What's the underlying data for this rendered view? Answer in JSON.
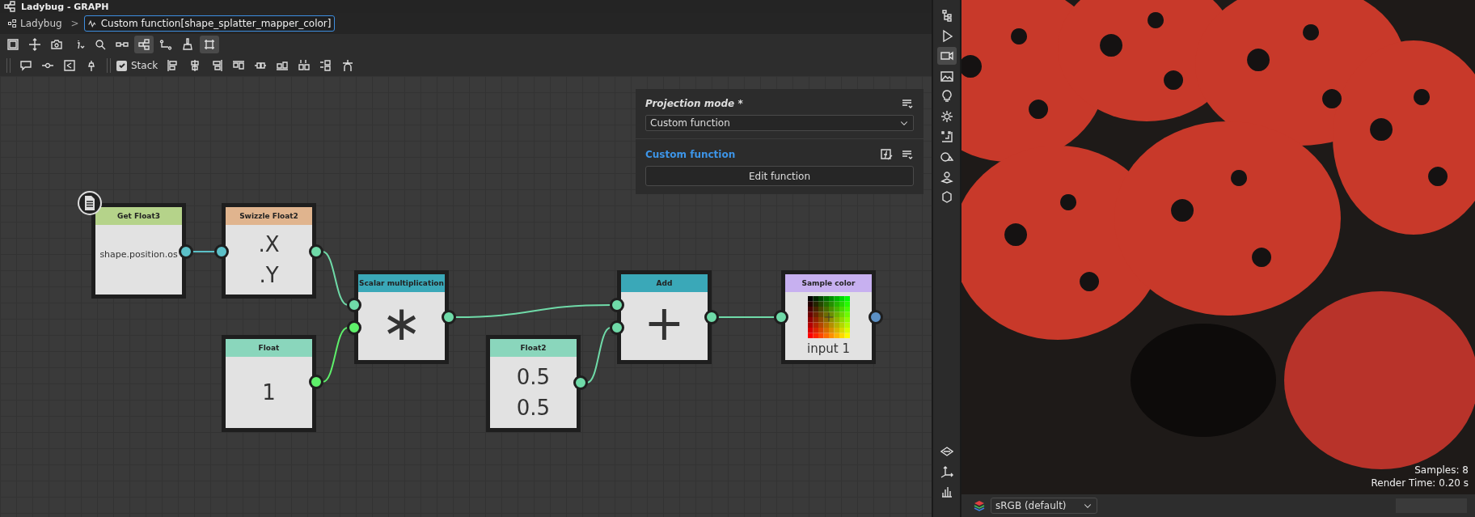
{
  "window": {
    "title": "Ladybug - GRAPH"
  },
  "breadcrumb": {
    "root": "Ladybug",
    "separator": ">",
    "current": "Custom function[shape_splatter_mapper_color]"
  },
  "toolbar_1": [
    {
      "selected": false
    },
    {
      "selected": false
    },
    {
      "selected": false
    },
    {
      "selected": false
    },
    {
      "selected": false
    },
    {
      "selected": false
    },
    {
      "selected": true
    },
    {
      "selected": false
    },
    {
      "selected": false
    },
    {
      "selected": true
    }
  ],
  "toolbar_2": {
    "stack": {
      "label": "Stack",
      "checked": true
    }
  },
  "nodes": [
    {
      "kind": "text",
      "title": "Get Float3",
      "color": "#b5d38a",
      "lines": [
        "shape.position.os"
      ]
    },
    {
      "kind": "values",
      "title": "Swizzle Float2",
      "color": "#e0b48e",
      "lines": [
        ".X",
        ".Y"
      ]
    },
    {
      "kind": "operator",
      "title": "Scalar multiplication",
      "color": "#3aa8b8",
      "lines": [
        "∗"
      ]
    },
    {
      "kind": "values",
      "title": "Float",
      "color": "#8ad6bc",
      "lines": [
        "1"
      ]
    },
    {
      "kind": "values",
      "title": "Float2",
      "color": "#8ad6bc",
      "lines": [
        "0.5",
        "0.5"
      ]
    },
    {
      "kind": "operator",
      "title": "Add",
      "color": "#3aa8b8",
      "lines": [
        "+"
      ]
    },
    {
      "kind": "color",
      "title": "Sample color",
      "color": "#c7b0f0",
      "lines": [
        "input 1"
      ]
    }
  ],
  "properties": {
    "projection_label": "Projection mode *",
    "projection_value": "Custom function",
    "section": "Custom function",
    "button": "Edit function"
  },
  "side_tools": [
    {
      "selected": false
    },
    {
      "selected": false
    },
    {
      "selected": true
    },
    {
      "selected": false
    },
    {
      "selected": false
    },
    {
      "selected": false
    },
    {
      "selected": false
    },
    {
      "selected": false
    },
    {
      "selected": false
    },
    {
      "selected": false
    },
    {
      "selected": false
    },
    {
      "selected": false
    },
    {
      "selected": false
    }
  ],
  "viewport": {
    "samples": "Samples: 8",
    "render_time": "Render Time: 0.20 s",
    "color_space": "sRGB (default)"
  }
}
